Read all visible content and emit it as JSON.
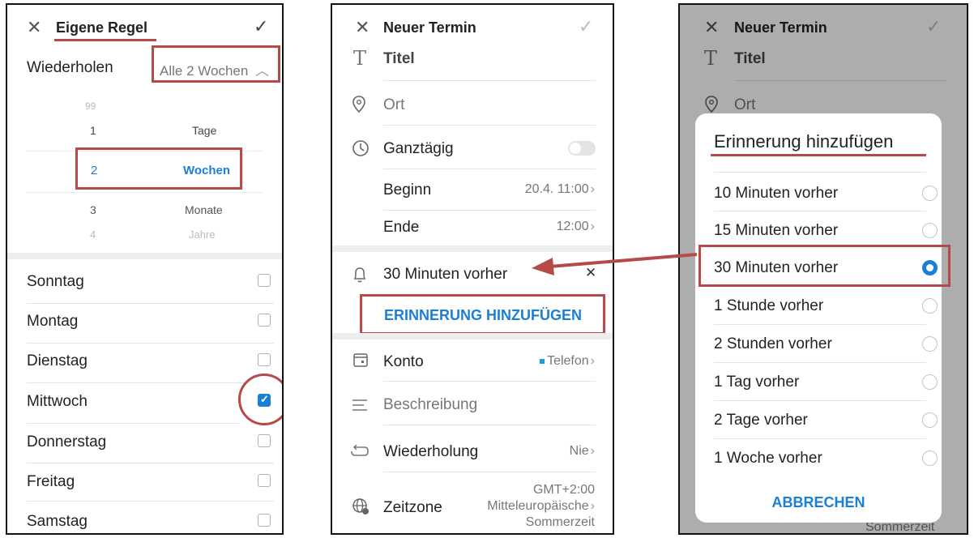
{
  "panel1": {
    "title": "Eigene Regel",
    "repeat_label": "Wiederholen",
    "repeat_value": "Alle 2 Wochen",
    "picker": {
      "above": "99",
      "rows": [
        {
          "num": "1",
          "unit": "Tage"
        },
        {
          "num": "2",
          "unit": "Wochen"
        },
        {
          "num": "3",
          "unit": "Monate"
        },
        {
          "num": "4",
          "unit": "Jahre"
        }
      ]
    },
    "days": [
      {
        "label": "Sonntag",
        "checked": false
      },
      {
        "label": "Montag",
        "checked": false
      },
      {
        "label": "Dienstag",
        "checked": false
      },
      {
        "label": "Mittwoch",
        "checked": true
      },
      {
        "label": "Donnerstag",
        "checked": false
      },
      {
        "label": "Freitag",
        "checked": false
      },
      {
        "label": "Samstag",
        "checked": false
      }
    ]
  },
  "panel2": {
    "title": "Neuer Termin",
    "title_placeholder": "Titel",
    "location_placeholder": "Ort",
    "allday_label": "Ganztägig",
    "start_label": "Beginn",
    "start_value": "20.4. 11:00",
    "end_label": "Ende",
    "end_value": "12:00",
    "reminder_value": "30 Minuten vorher",
    "add_reminder": "ERINNERUNG HINZUFÜGEN",
    "account_label": "Konto",
    "account_value": "Telefon",
    "description_placeholder": "Beschreibung",
    "repeat_label": "Wiederholung",
    "repeat_value": "Nie",
    "timezone_label": "Zeitzone",
    "timezone_line1": "GMT+2:00",
    "timezone_line2": "Mitteleuropäische",
    "timezone_line3": "Sommerzeit"
  },
  "panel3": {
    "background": {
      "title": "Neuer Termin",
      "title_placeholder": "Titel",
      "location_placeholder": "Ort",
      "peek_text": "Sommerzeit"
    },
    "dialog": {
      "title": "Erinnerung hinzufügen",
      "options": [
        {
          "label": "10 Minuten vorher",
          "selected": false
        },
        {
          "label": "15 Minuten vorher",
          "selected": false
        },
        {
          "label": "30 Minuten vorher",
          "selected": true
        },
        {
          "label": "1 Stunde vorher",
          "selected": false
        },
        {
          "label": "2 Stunden vorher",
          "selected": false
        },
        {
          "label": "1 Tag vorher",
          "selected": false
        },
        {
          "label": "2 Tage vorher",
          "selected": false
        },
        {
          "label": "1 Woche vorher",
          "selected": false
        }
      ],
      "cancel": "ABBRECHEN"
    }
  },
  "colors": {
    "accent_blue": "#1a7fd6",
    "annotation_red": "#b54a48",
    "selected_radio": "#1a7fd6"
  }
}
